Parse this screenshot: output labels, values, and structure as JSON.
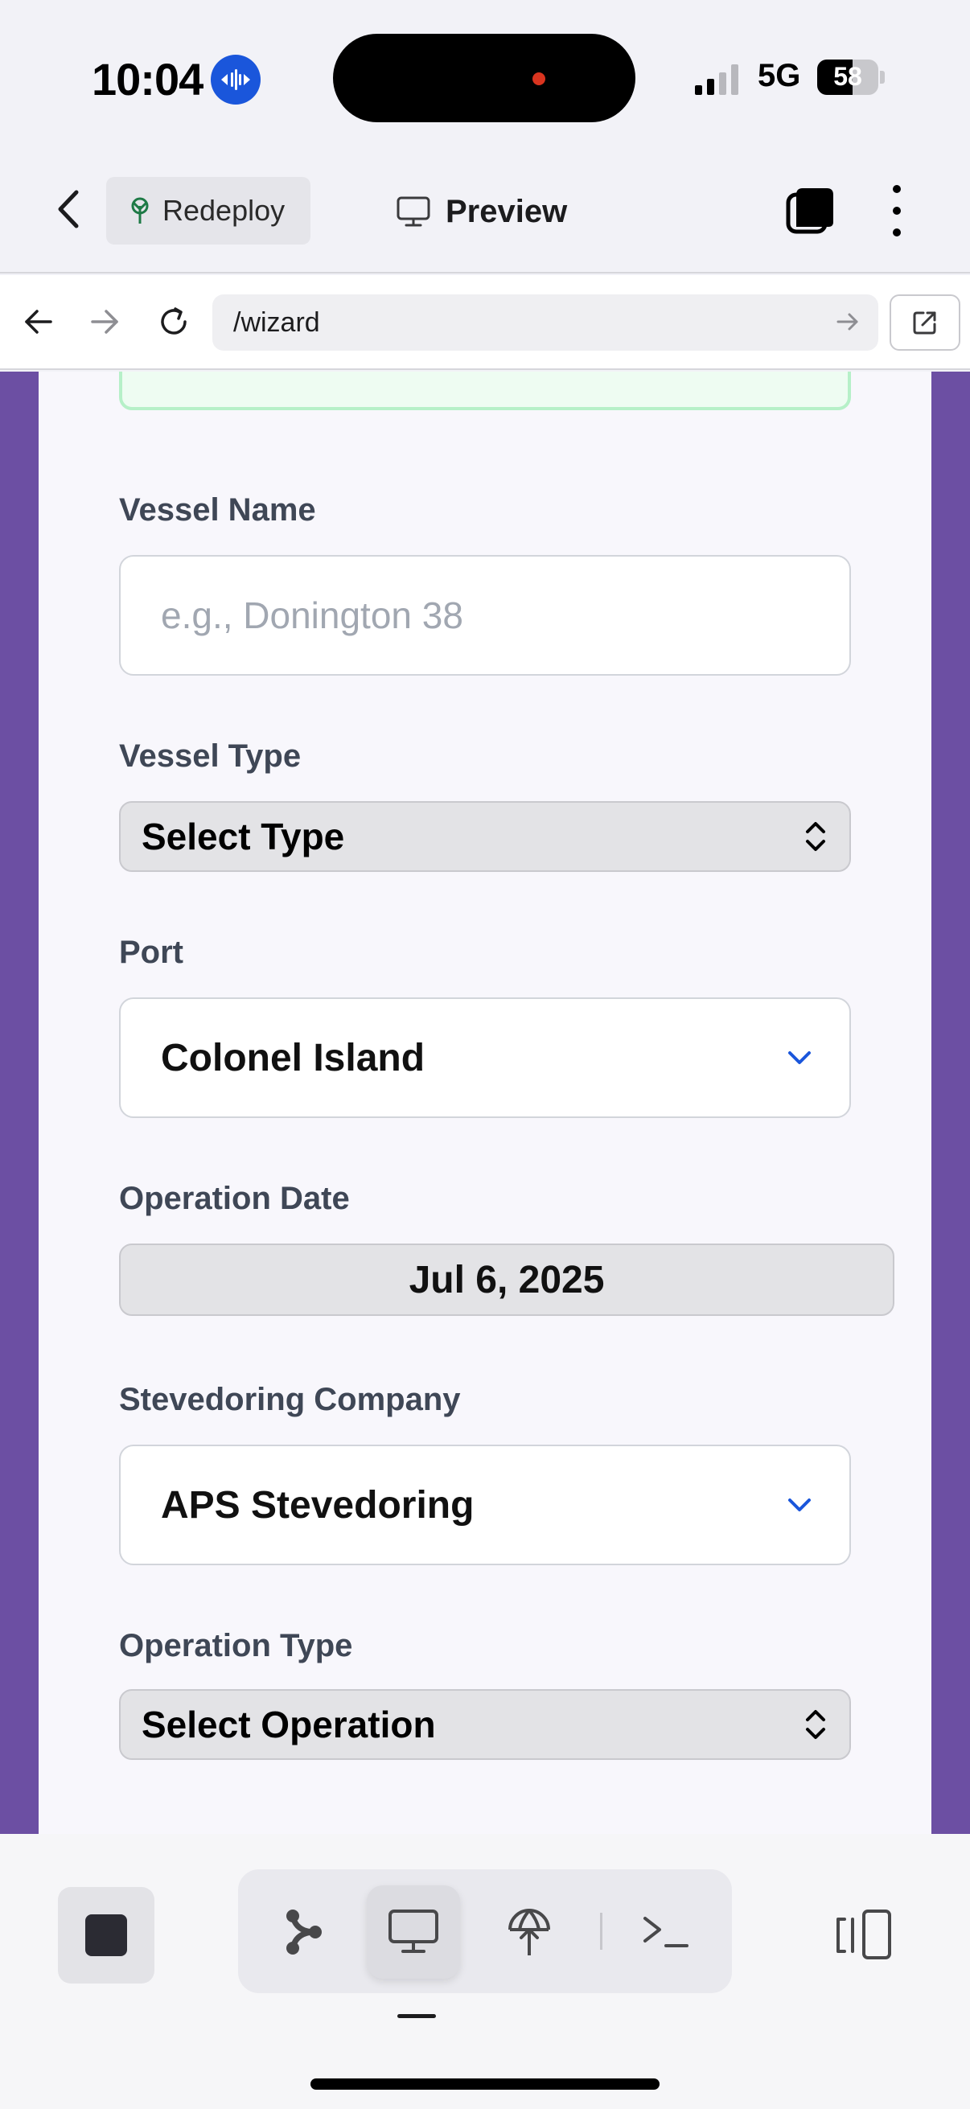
{
  "status_bar": {
    "time": "10:04",
    "network": "5G",
    "battery": "58",
    "battery_level": 0.58,
    "signal_bars_active": 2,
    "signal_bars_total": 4
  },
  "header": {
    "redeploy_label": "Redeploy",
    "preview_label": "Preview"
  },
  "browser": {
    "url": "/wizard"
  },
  "form": {
    "vessel_name": {
      "label": "Vessel Name",
      "placeholder": "e.g., Donington 38"
    },
    "vessel_type": {
      "label": "Vessel Type",
      "value": "Select Type"
    },
    "port": {
      "label": "Port",
      "value": "Colonel Island"
    },
    "operation_date": {
      "label": "Operation Date",
      "value": "Jul 6, 2025"
    },
    "stevedoring_company": {
      "label": "Stevedoring Company",
      "value": "APS Stevedoring"
    },
    "operation_type": {
      "label": "Operation Type",
      "value": "Select Operation"
    }
  },
  "colors": {
    "page_background": "#6c4fa3",
    "card_background": "#f8f7fc",
    "accent": "#1a56db",
    "success_border": "#b6f0c8"
  },
  "toolbar": {
    "icons": [
      "stop-icon",
      "branch-icon",
      "monitor-icon",
      "deploy-icon",
      "terminal-icon",
      "layout-icon"
    ],
    "active": "monitor-icon"
  }
}
